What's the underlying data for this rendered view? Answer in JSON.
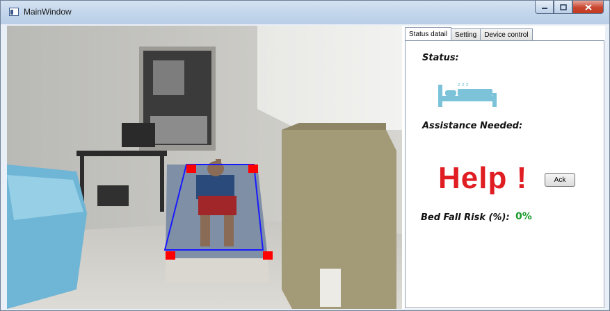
{
  "window": {
    "title": "MainWindow"
  },
  "tabs": [
    {
      "label": "Status datail",
      "active": true
    },
    {
      "label": "Setting",
      "active": false
    },
    {
      "label": "Device control",
      "active": false
    }
  ],
  "status": {
    "status_label": "Status:",
    "status_icon": "sleeping-bed-icon",
    "assistance_label": "Assistance Needed:",
    "assistance_value": "Help !",
    "ack_label": "Ack",
    "risk_label": "Bed Fall Risk (%):",
    "risk_value": "0%"
  },
  "colors": {
    "help": "#e01d22",
    "risk": "#1a9a2a",
    "bed_icon": "#7cc3d9",
    "detection_box": "#1a1aff",
    "corner_markers": "#ff0000"
  }
}
